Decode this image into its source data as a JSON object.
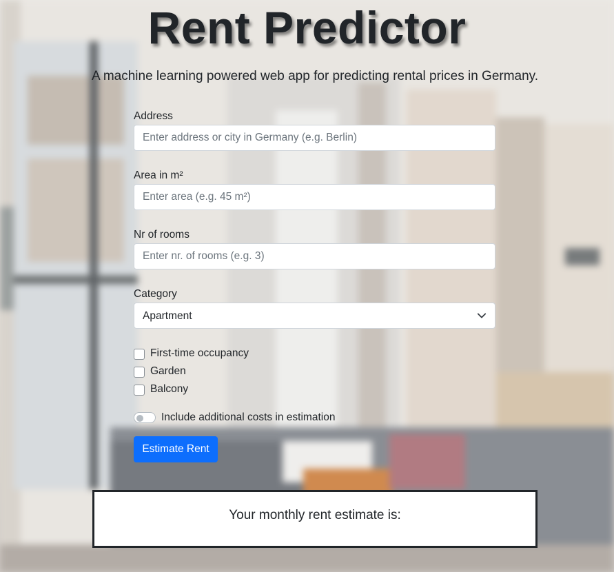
{
  "header": {
    "title": "Rent Predictor",
    "subtitle": "A machine learning powered web app for predicting rental prices in Germany."
  },
  "form": {
    "address": {
      "label": "Address",
      "placeholder": "Enter address or city in Germany (e.g. Berlin)",
      "value": ""
    },
    "area": {
      "label": "Area in m²",
      "placeholder": "Enter area (e.g. 45 m²)",
      "value": ""
    },
    "rooms": {
      "label": "Nr of rooms",
      "placeholder": "Enter nr. of rooms (e.g. 3)",
      "value": ""
    },
    "category": {
      "label": "Category",
      "selected": "Apartment",
      "icon": "chevron-down-icon"
    },
    "checkboxes": [
      {
        "label": "First-time occupancy",
        "checked": false
      },
      {
        "label": "Garden",
        "checked": false
      },
      {
        "label": "Balcony",
        "checked": false
      }
    ],
    "toggle": {
      "label": "Include additional costs in estimation",
      "on": false
    },
    "submit_label": "Estimate Rent"
  },
  "result": {
    "label": "Your monthly rent estimate is:"
  },
  "colors": {
    "primary": "#0d6efd",
    "text": "#212529",
    "placeholder": "#6c757d",
    "border": "#ced4da"
  }
}
